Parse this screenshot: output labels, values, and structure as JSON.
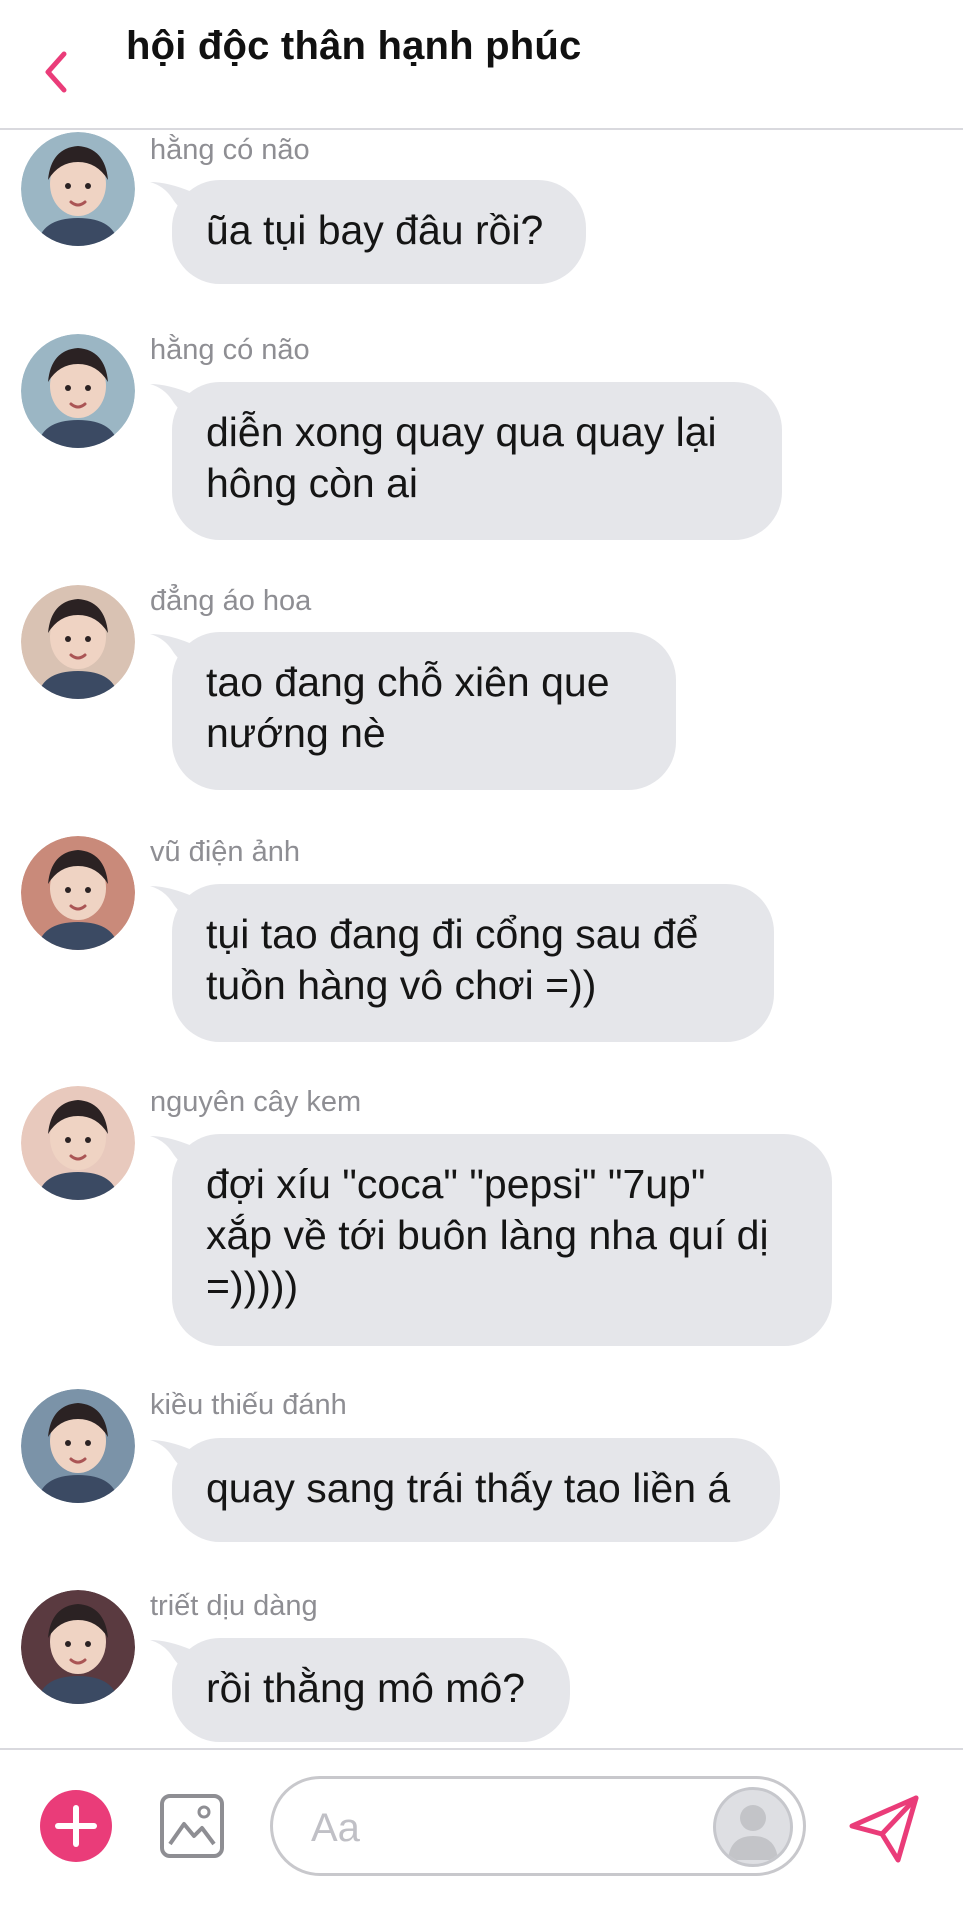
{
  "header": {
    "title": "hội độc thân hạnh phúc",
    "accent": "#ea3c79"
  },
  "messages": [
    {
      "sender": "hằng có não",
      "lines": [
        "ũa tụi bay đâu rồi?"
      ],
      "avatar": "avatar-hang",
      "avatar_color": "#9bb6c4"
    },
    {
      "sender": "hằng có não",
      "lines": [
        "diễn xong quay qua quay lại",
        "hông còn ai"
      ],
      "avatar": "avatar-hang",
      "avatar_color": "#9bb6c4"
    },
    {
      "sender": "đẳng áo hoa",
      "lines": [
        "tao đang chỗ xiên que",
        "nướng nè"
      ],
      "avatar": "avatar-dang",
      "avatar_color": "#d9c2b3"
    },
    {
      "sender": "vũ điện ảnh",
      "lines": [
        "tụi tao đang đi cổng sau để",
        "tuồn hàng vô chơi =))"
      ],
      "avatar": "avatar-vu",
      "avatar_color": "#c98a7a"
    },
    {
      "sender": "nguyên cây kem",
      "lines": [
        "đợi xíu \"coca\" \"pepsi\" \"7up\"",
        "xắp về tới buôn làng nha quí dị",
        "=)))))"
      ],
      "avatar": "avatar-nguyen",
      "avatar_color": "#e8c9bd"
    },
    {
      "sender": "kiều thiếu đánh",
      "lines": [
        "quay sang trái thấy tao liền á"
      ],
      "avatar": "avatar-kieu",
      "avatar_color": "#7b93a8"
    },
    {
      "sender": "triết dịu dàng",
      "lines": [
        "rồi thằng mô mô?"
      ],
      "avatar": "avatar-triet",
      "avatar_color": "#5a3a40"
    }
  ],
  "composer": {
    "placeholder": "Aa"
  },
  "colors": {
    "bubble": "#e5e6ea",
    "accent": "#ea3c79",
    "muted": "#8e8e93"
  },
  "icons": [
    "chevron-left-icon",
    "plus-icon",
    "image-icon",
    "profile-icon",
    "send-icon"
  ]
}
